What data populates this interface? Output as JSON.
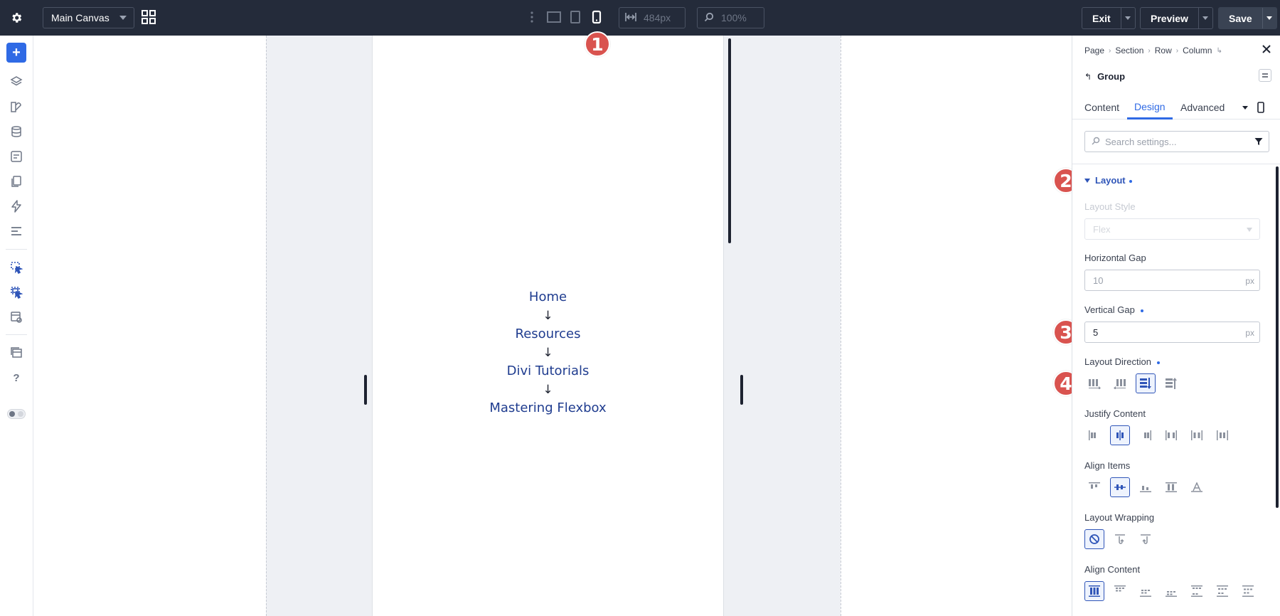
{
  "topbar": {
    "canvas_label": "Main Canvas",
    "width_value": "484px",
    "zoom_value": "100%",
    "exit_label": "Exit",
    "preview_label": "Preview",
    "save_label": "Save"
  },
  "canvas": {
    "nav_items": [
      "Home",
      "Resources",
      "Divi Tutorials",
      "Mastering Flexbox"
    ],
    "arrow": "↓"
  },
  "badges": [
    "1",
    "2",
    "3",
    "4"
  ],
  "panel": {
    "breadcrumbs": [
      "Page",
      "Section",
      "Row",
      "Column"
    ],
    "group_title": "Group",
    "tabs": [
      "Content",
      "Design",
      "Advanced"
    ],
    "active_tab": "Design",
    "search_placeholder": "Search settings...",
    "section_title": "Layout",
    "layout_style_label": "Layout Style",
    "layout_style_value": "Flex",
    "horizontal_gap_label": "Horizontal Gap",
    "horizontal_gap_value": "10",
    "vertical_gap_label": "Vertical Gap",
    "vertical_gap_value": "5",
    "unit": "px",
    "layout_direction_label": "Layout Direction",
    "justify_content_label": "Justify Content",
    "align_items_label": "Align Items",
    "layout_wrapping_label": "Layout Wrapping",
    "align_content_label": "Align Content"
  },
  "colors": {
    "topbar_bg": "#242b3a",
    "accent": "#2f6ae5",
    "link": "#1f3c8f",
    "badge": "#d9534f"
  }
}
